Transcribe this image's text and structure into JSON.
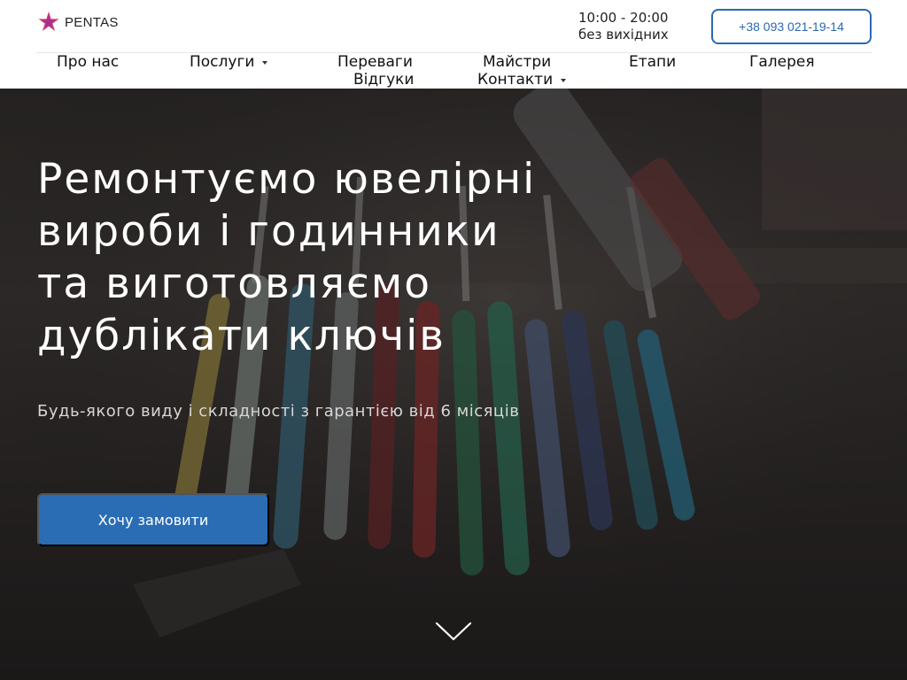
{
  "header": {
    "logo_text": "PENTAS",
    "hours_line1": "10:00 - 20:00",
    "hours_line2": "без вихідних",
    "phone": "+38 093 021-19-14"
  },
  "nav": {
    "about": "Про нас",
    "services": "Послуги",
    "advantages": "Переваги",
    "masters": "Майстри",
    "stages": "Етапи",
    "gallery": "Галерея",
    "reviews": "Відгуки",
    "contacts": "Контакти"
  },
  "hero": {
    "title_line1": "Ремонтуємо ювелірні",
    "title_line2": "вироби і годинники",
    "title_line3": "та виготовляємо",
    "title_line4": "дублікати ключів",
    "subtitle": "Будь-якого виду і складності з гарантією від 6 місяців",
    "cta": "Хочу замовити"
  },
  "colors": {
    "accent": "#2a6db5",
    "logo_star": "#c2185b"
  },
  "icons": {
    "logo": "star-logo-icon",
    "dropdown": "caret-down-icon",
    "scroll": "chevron-down-icon"
  }
}
